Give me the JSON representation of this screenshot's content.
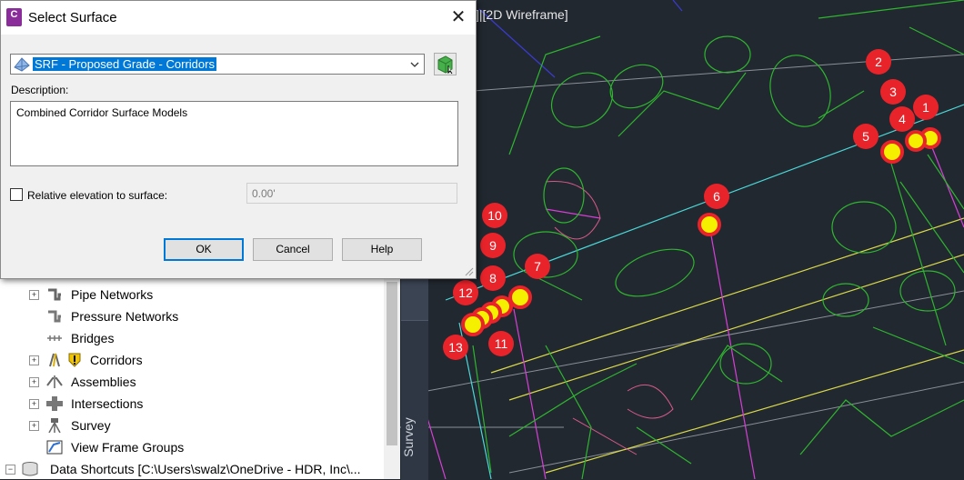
{
  "viewport": {
    "label": "]|[2D Wireframe]"
  },
  "dialog": {
    "app_icon_letter": "C",
    "title": "Select Surface",
    "surface_selected": "SRF - Proposed Grade - Corridors",
    "description_label": "Description:",
    "description_value": "Combined Corridor Surface Models",
    "relative_elevation_label": "Relative elevation to surface:",
    "relative_elevation_value": "0.00'",
    "ok_label": "OK",
    "cancel_label": "Cancel",
    "help_label": "Help"
  },
  "prospector": {
    "items": [
      {
        "label": "Pipe Networks",
        "icon": "pipe-networks-icon",
        "expander": "+"
      },
      {
        "label": "Pressure Networks",
        "icon": "pressure-networks-icon",
        "expander": ""
      },
      {
        "label": "Bridges",
        "icon": "bridges-icon",
        "expander": ""
      },
      {
        "label": "Corridors",
        "icon": "corridors-icon",
        "expander": "+"
      },
      {
        "label": "Assemblies",
        "icon": "assemblies-icon",
        "expander": "+"
      },
      {
        "label": "Intersections",
        "icon": "intersections-icon",
        "expander": "+"
      },
      {
        "label": "Survey",
        "icon": "survey-icon",
        "expander": "+"
      },
      {
        "label": "View Frame Groups",
        "icon": "view-frame-groups-icon",
        "expander": ""
      }
    ],
    "data_shortcuts": {
      "label": "Data Shortcuts [C:\\Users\\swalz\\OneDrive - HDR, Inc\\...",
      "expander": "−"
    }
  },
  "side_tab": {
    "label": "Survey"
  },
  "markers": [
    "1",
    "2",
    "3",
    "4",
    "5",
    "6",
    "7",
    "8",
    "9",
    "10",
    "11",
    "12",
    "13"
  ],
  "colors": {
    "canvas_bg": "#212830",
    "marker_red": "#e8232a",
    "marker_yellow": "#f5f000",
    "selection_blue": "#0078d7",
    "line_green": "#2fb52f",
    "line_yellow": "#d9d94a",
    "line_cyan": "#4bd8d8",
    "line_magenta": "#d640d6"
  }
}
